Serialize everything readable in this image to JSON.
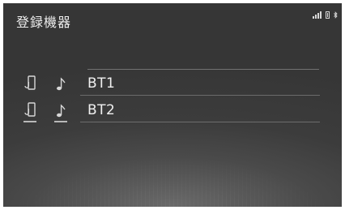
{
  "screen": {
    "title": "登録機器",
    "status_icons": [
      "signal-icon",
      "battery-icon",
      "bluetooth-icon"
    ]
  },
  "devices": [
    {
      "label": "BT1",
      "icons": [
        "phone-icon",
        "music-note-icon"
      ]
    },
    {
      "label": "BT2",
      "icons": [
        "phone-icon",
        "music-note-icon"
      ]
    }
  ],
  "colors": {
    "background": "#3c3c3c",
    "text": "#f0f0f0",
    "divider": "#8a8a8a"
  }
}
